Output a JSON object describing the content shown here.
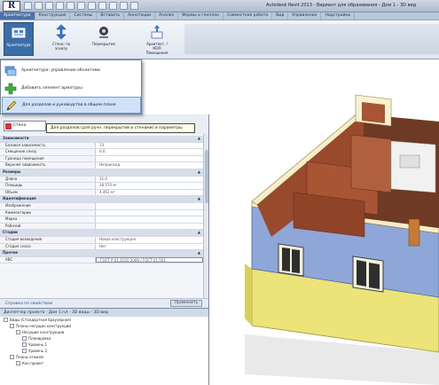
{
  "app": {
    "logo": "R",
    "title": "Autodesk Revit 2013 - Вариант для образования - Дом 1 - 3D вид"
  },
  "ribbon_tabs": [
    "Архитектура",
    "Конструкция",
    "Системы",
    "Вставить",
    "Аннотации",
    "Анализ",
    "Формы и генплан",
    "Совместная работа",
    "Вид",
    "Управление",
    "Надстройки"
  ],
  "ribbon_buttons": [
    {
      "label": "Архитектура",
      "icon": "wall-tool-icon",
      "selected": true
    },
    {
      "label": "Стена: по эскизу",
      "icon": "structure-tool-icon",
      "selected": false
    },
    {
      "label": "Перекрытие",
      "icon": "floor-tool-icon",
      "selected": false
    },
    {
      "label": "Архитект. / МЭП Помещения",
      "icon": "room-tool-icon",
      "selected": false
    }
  ],
  "dropdown": {
    "items": [
      {
        "label": "Архитектура: управление объектами",
        "icon": "layers-icon",
        "highlighted": false
      },
      {
        "label": "Добавить элемент арматуры",
        "icon": "add-plus-icon",
        "highlighted": false
      },
      {
        "label": "Для разделов и руководства в общем плане",
        "icon": "pencil-icon",
        "highlighted": true
      }
    ]
  },
  "tooltip": "Для разделов (для ручн. перекрытий и стенами) и параметры",
  "properties": {
    "type_selector": "Стена",
    "rows": [
      {
        "type": "category",
        "label": "Зависимости",
        "toggle": "▲"
      },
      {
        "type": "row",
        "k": "Базовая зависимость",
        "v": "1Э"
      },
      {
        "type": "row",
        "k": "Смещение снизу",
        "v": "0.0"
      },
      {
        "type": "row",
        "k": "Граница помещения",
        "v": ""
      },
      {
        "type": "row",
        "k": "Верхняя зависимость",
        "v": "Неприсоед."
      },
      {
        "type": "category",
        "label": "Размеры",
        "toggle": "▲"
      },
      {
        "type": "row",
        "k": "Длина",
        "v": "12.0"
      },
      {
        "type": "row",
        "k": "Площадь",
        "v": "18.570 м²"
      },
      {
        "type": "row",
        "k": "Объем",
        "v": "4.461 м³"
      },
      {
        "type": "category",
        "label": "Идентификация",
        "toggle": "▲"
      },
      {
        "type": "row",
        "k": "Изображение",
        "v": ""
      },
      {
        "type": "row",
        "k": "Комментарии",
        "v": ""
      },
      {
        "type": "row",
        "k": "Марка",
        "v": ""
      },
      {
        "type": "row",
        "k": "Рабочий",
        "v": ""
      },
      {
        "type": "category",
        "label": "Стадии",
        "toggle": "▲"
      },
      {
        "type": "row",
        "k": "Стадия возведения",
        "v": "Новая конструкция"
      },
      {
        "type": "row",
        "k": "Стадия сноса",
        "v": "Нет"
      },
      {
        "type": "category",
        "label": "Прочее",
        "toggle": "▲"
      },
      {
        "type": "field",
        "k": "АВС",
        "v": "ГОСТ Р 21.1101-2009 / ГОСТ 21.501"
      }
    ],
    "help_link": "Справка по свойствам",
    "apply_label": "Применить"
  },
  "browser": {
    "title": "Диспетчер проекта - Дом 1.rvt - 3D виды - 3D вид",
    "nodes": [
      {
        "label": "Виды (Стандартная браузерная)",
        "indent": 0
      },
      {
        "label": "Планы несущих конструкций",
        "indent": 1
      },
      {
        "label": "Несущие конструкции",
        "indent": 2
      },
      {
        "label": "Планировка",
        "indent": 3
      },
      {
        "label": "Уровень 1",
        "indent": 3
      },
      {
        "label": "Уровень 2",
        "indent": 3
      },
      {
        "label": "Планы этажей",
        "indent": 1
      },
      {
        "label": "Кон.проект",
        "indent": 2
      }
    ]
  },
  "colors": {
    "ribbon_accent": "#3b6ea8",
    "wall_brick": "#9a4a2c",
    "wall_blue": "#8ea7d8",
    "plinth_yellow": "#ece479",
    "highlight": "#cfe2f7"
  }
}
